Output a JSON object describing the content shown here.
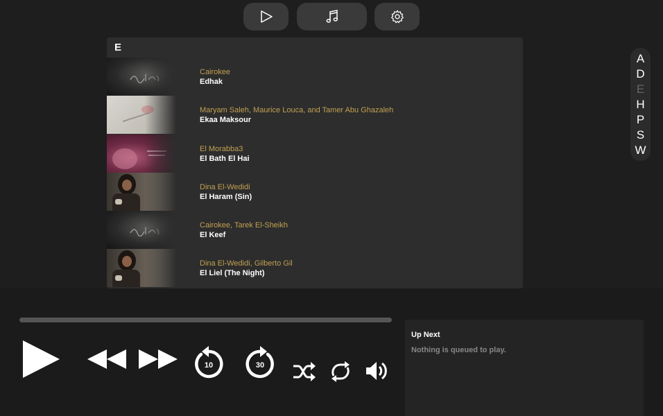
{
  "nav": {
    "buttons": [
      "play",
      "music",
      "settings"
    ]
  },
  "library": {
    "section_letter": "E",
    "tracks": [
      {
        "artists": [
          "Cairokee"
        ],
        "title": "Edhak",
        "art": "dark-calligraphy"
      },
      {
        "artists": [
          "Maryam Saleh",
          "Maurice Louca",
          "and Tamer Abu Ghazaleh"
        ],
        "title": "Ekaa Maksour",
        "art": "light-paper"
      },
      {
        "artists": [
          "El Morabba3"
        ],
        "title": "El Bath El Hai",
        "art": "pink-face"
      },
      {
        "artists": [
          "Dina El-Wedidi"
        ],
        "title": "El Haram (Sin)",
        "art": "portrait"
      },
      {
        "artists": [
          "Cairokee",
          "Tarek El-Sheikh"
        ],
        "title": "El Keef",
        "art": "dark-calligraphy"
      },
      {
        "artists": [
          "Dina El-Wedidi",
          "Gilberto Gil"
        ],
        "title": "El Liel (The Night)",
        "art": "portrait"
      }
    ]
  },
  "alphabet": {
    "letters": [
      "A",
      "D",
      "E",
      "H",
      "P",
      "S",
      "W"
    ],
    "current": "E"
  },
  "player": {
    "progress": 0,
    "skip_back_seconds": "10",
    "skip_forward_seconds": "30"
  },
  "up_next": {
    "title": "Up Next",
    "empty_message": "Nothing is queued to play."
  },
  "colors": {
    "background": "#1e1e1e",
    "panel": "#2d2d2d",
    "artist_accent": "#c2a052"
  }
}
